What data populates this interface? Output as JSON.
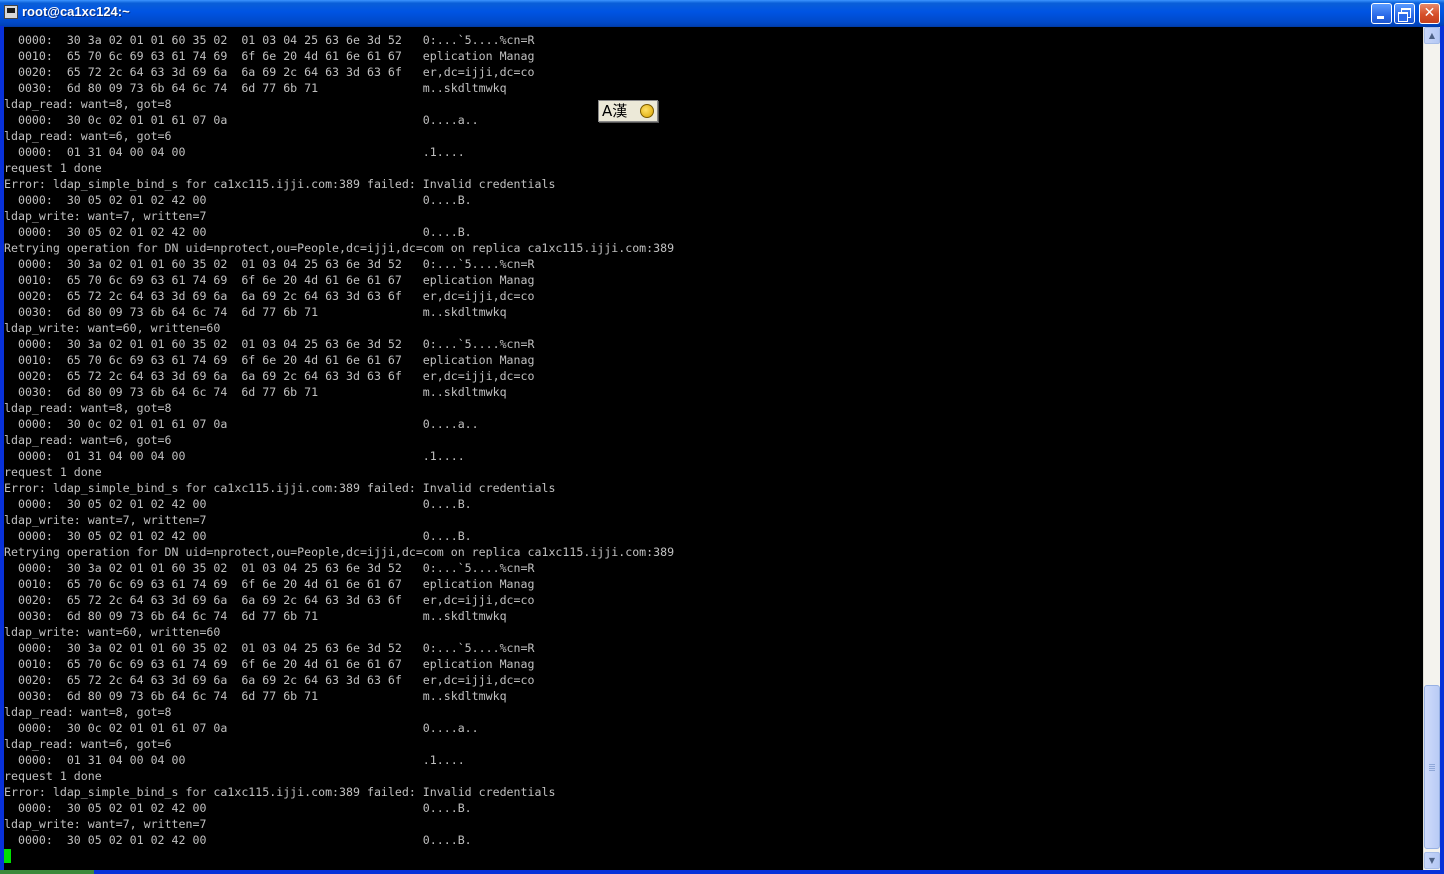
{
  "window": {
    "title": "root@ca1xc124:~"
  },
  "ime": {
    "label": "A漢"
  },
  "terminal": {
    "lines": [
      "  0000:  30 3a 02 01 01 60 35 02  01 03 04 25 63 6e 3d 52   0:...`5....%cn=R",
      "  0010:  65 70 6c 69 63 61 74 69  6f 6e 20 4d 61 6e 61 67   eplication Manag",
      "  0020:  65 72 2c 64 63 3d 69 6a  6a 69 2c 64 63 3d 63 6f   er,dc=ijji,dc=co",
      "  0030:  6d 80 09 73 6b 64 6c 74  6d 77 6b 71               m..skdltmwkq",
      "ldap_read: want=8, got=8",
      "  0000:  30 0c 02 01 01 61 07 0a                            0....a..",
      "ldap_read: want=6, got=6",
      "  0000:  01 31 04 00 04 00                                  .1....",
      "request 1 done",
      "Error: ldap_simple_bind_s for ca1xc115.ijji.com:389 failed: Invalid credentials",
      "  0000:  30 05 02 01 02 42 00                               0....B.",
      "ldap_write: want=7, written=7",
      "  0000:  30 05 02 01 02 42 00                               0....B.",
      "Retrying operation for DN uid=nprotect,ou=People,dc=ijji,dc=com on replica ca1xc115.ijji.com:389",
      "  0000:  30 3a 02 01 01 60 35 02  01 03 04 25 63 6e 3d 52   0:...`5....%cn=R",
      "  0010:  65 70 6c 69 63 61 74 69  6f 6e 20 4d 61 6e 61 67   eplication Manag",
      "  0020:  65 72 2c 64 63 3d 69 6a  6a 69 2c 64 63 3d 63 6f   er,dc=ijji,dc=co",
      "  0030:  6d 80 09 73 6b 64 6c 74  6d 77 6b 71               m..skdltmwkq",
      "ldap_write: want=60, written=60",
      "  0000:  30 3a 02 01 01 60 35 02  01 03 04 25 63 6e 3d 52   0:...`5....%cn=R",
      "  0010:  65 70 6c 69 63 61 74 69  6f 6e 20 4d 61 6e 61 67   eplication Manag",
      "  0020:  65 72 2c 64 63 3d 69 6a  6a 69 2c 64 63 3d 63 6f   er,dc=ijji,dc=co",
      "  0030:  6d 80 09 73 6b 64 6c 74  6d 77 6b 71               m..skdltmwkq",
      "ldap_read: want=8, got=8",
      "  0000:  30 0c 02 01 01 61 07 0a                            0....a..",
      "ldap_read: want=6, got=6",
      "  0000:  01 31 04 00 04 00                                  .1....",
      "request 1 done",
      "Error: ldap_simple_bind_s for ca1xc115.ijji.com:389 failed: Invalid credentials",
      "  0000:  30 05 02 01 02 42 00                               0....B.",
      "ldap_write: want=7, written=7",
      "  0000:  30 05 02 01 02 42 00                               0....B.",
      "Retrying operation for DN uid=nprotect,ou=People,dc=ijji,dc=com on replica ca1xc115.ijji.com:389",
      "  0000:  30 3a 02 01 01 60 35 02  01 03 04 25 63 6e 3d 52   0:...`5....%cn=R",
      "  0010:  65 70 6c 69 63 61 74 69  6f 6e 20 4d 61 6e 61 67   eplication Manag",
      "  0020:  65 72 2c 64 63 3d 69 6a  6a 69 2c 64 63 3d 63 6f   er,dc=ijji,dc=co",
      "  0030:  6d 80 09 73 6b 64 6c 74  6d 77 6b 71               m..skdltmwkq",
      "ldap_write: want=60, written=60",
      "  0000:  30 3a 02 01 01 60 35 02  01 03 04 25 63 6e 3d 52   0:...`5....%cn=R",
      "  0010:  65 70 6c 69 63 61 74 69  6f 6e 20 4d 61 6e 61 67   eplication Manag",
      "  0020:  65 72 2c 64 63 3d 69 6a  6a 69 2c 64 63 3d 63 6f   er,dc=ijji,dc=co",
      "  0030:  6d 80 09 73 6b 64 6c 74  6d 77 6b 71               m..skdltmwkq",
      "ldap_read: want=8, got=8",
      "  0000:  30 0c 02 01 01 61 07 0a                            0....a..",
      "ldap_read: want=6, got=6",
      "  0000:  01 31 04 00 04 00                                  .1....",
      "request 1 done",
      "Error: ldap_simple_bind_s for ca1xc115.ijji.com:389 failed: Invalid credentials",
      "  0000:  30 05 02 01 02 42 00                               0....B.",
      "ldap_write: want=7, written=7",
      "  0000:  30 05 02 01 02 42 00                               0....B."
    ]
  },
  "scrollbar": {
    "position_fraction": 0.98
  },
  "colors": {
    "terminal_bg": "#000000",
    "terminal_fg": "#c0c0c0",
    "cursor": "#00e000",
    "titlebar": "#0054e3"
  }
}
